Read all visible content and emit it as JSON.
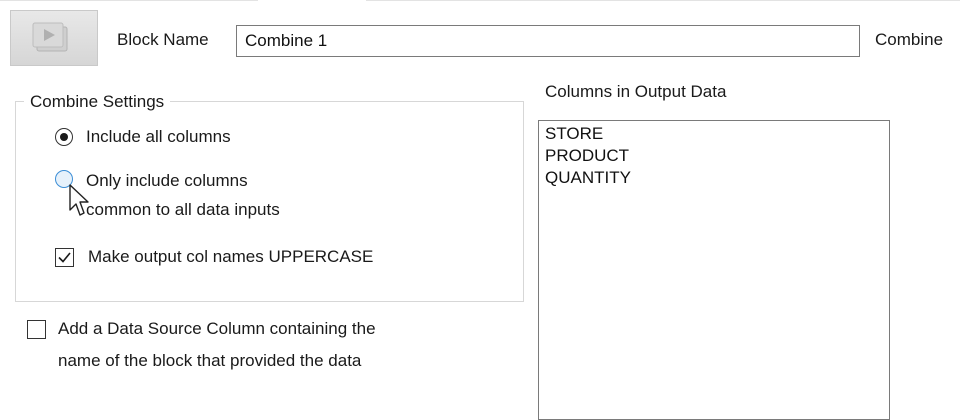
{
  "block": {
    "icon": "block-play-icon",
    "name_label": "Block Name",
    "name_value": "Combine 1",
    "type_label": "Combine"
  },
  "settings": {
    "group_title": "Combine Settings",
    "radio_include_all": {
      "label": "Include all columns",
      "checked": true
    },
    "radio_only_common": {
      "label_line1": "Only include columns",
      "label_line2": "common to all data inputs",
      "checked": false
    },
    "checkbox_uppercase": {
      "label": "Make output col names UPPERCASE",
      "checked": true
    }
  },
  "data_source": {
    "label_line1": "Add a Data Source Column containing the",
    "label_line2": "name of the block that provided the data",
    "checked": false
  },
  "output": {
    "title": "Columns in Output Data",
    "columns": [
      "STORE",
      "PRODUCT",
      "QUANTITY"
    ]
  }
}
